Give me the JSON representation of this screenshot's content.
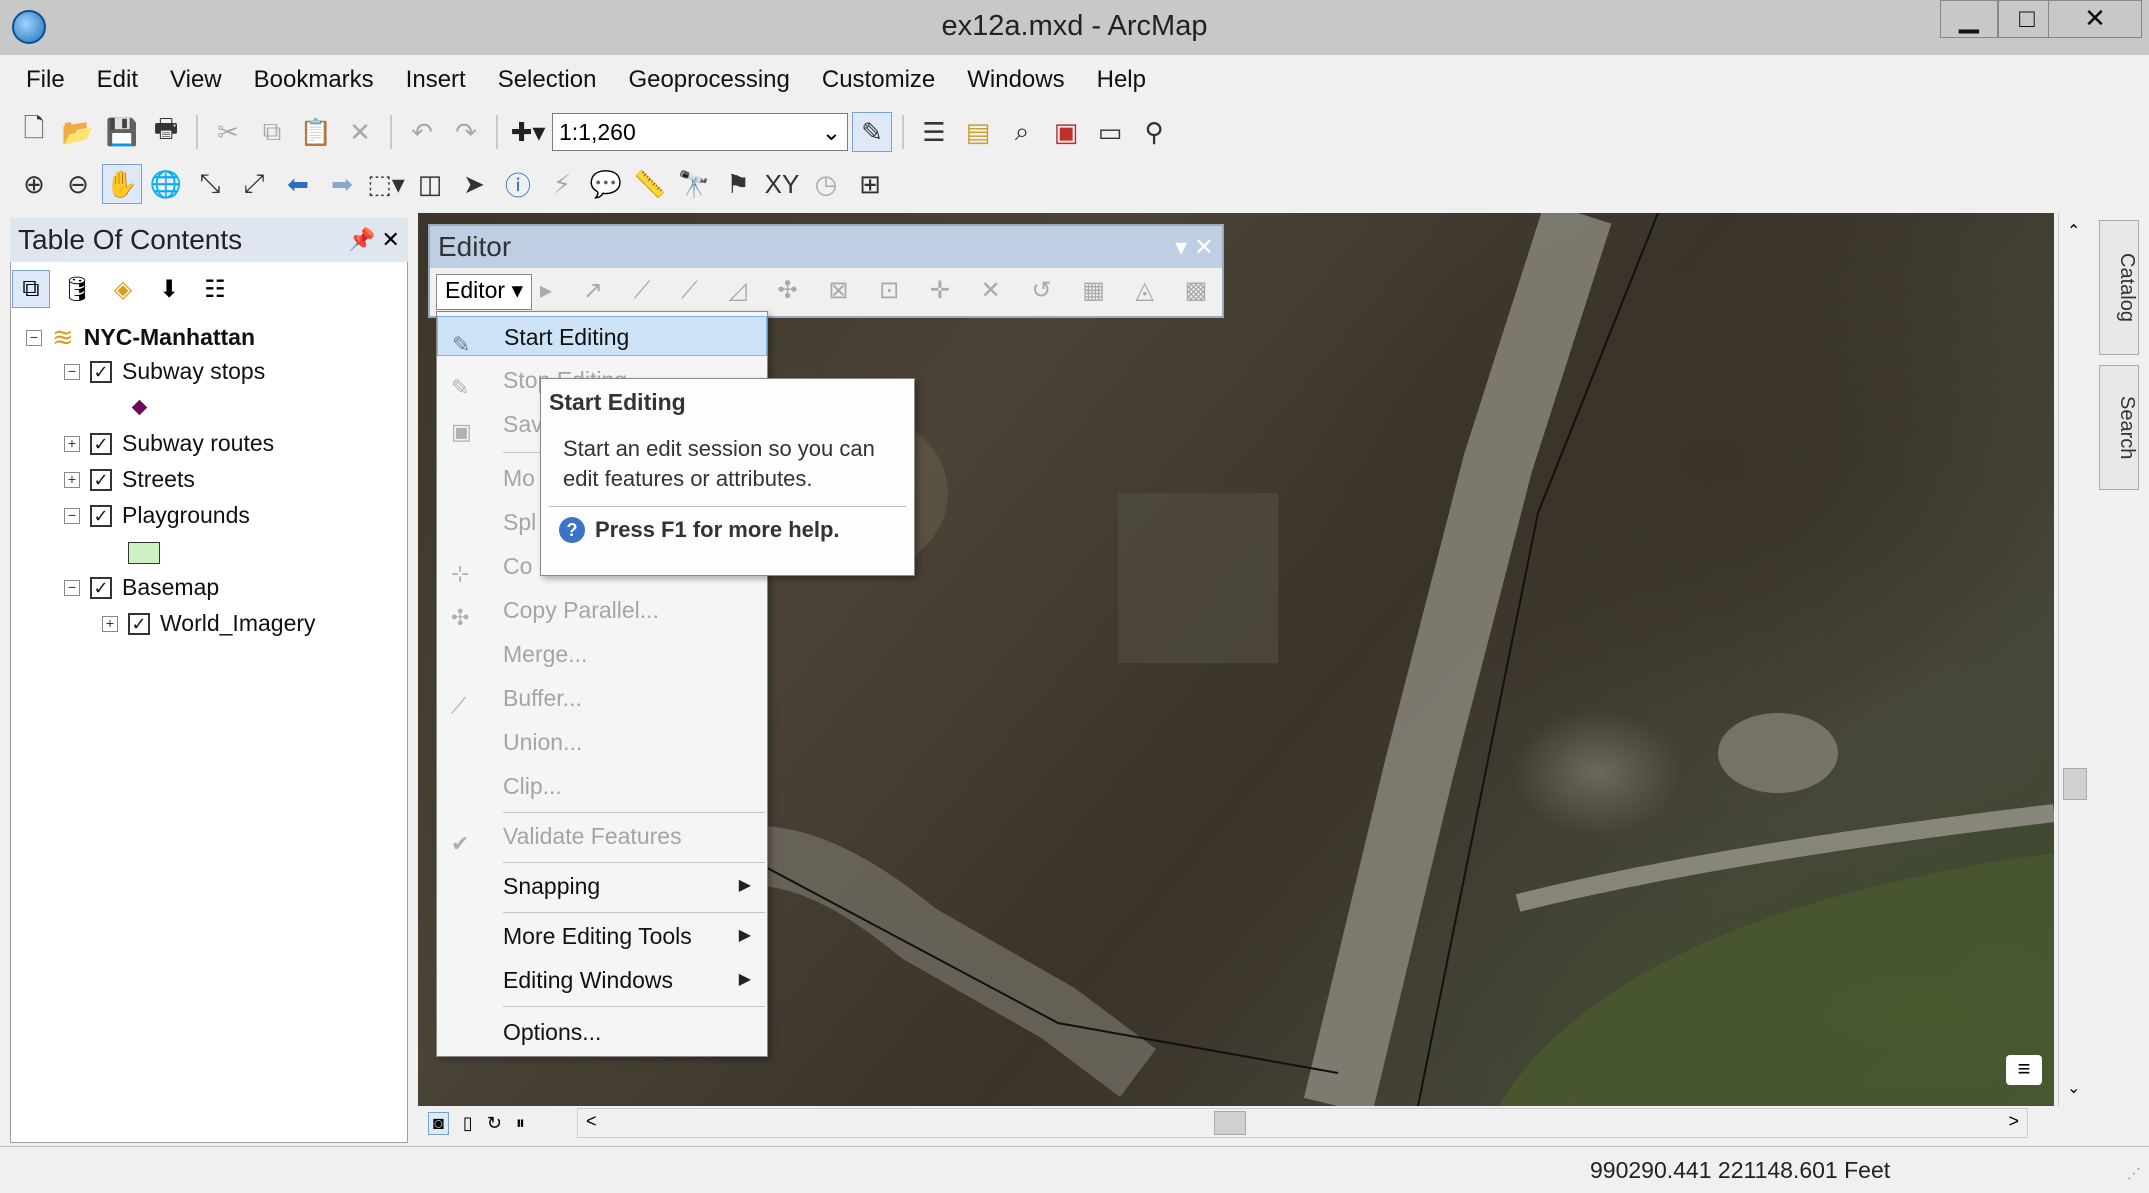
{
  "window": {
    "title": "ex12a.mxd - ArcMap"
  },
  "menubar": [
    "File",
    "Edit",
    "View",
    "Bookmarks",
    "Insert",
    "Selection",
    "Geoprocessing",
    "Customize",
    "Windows",
    "Help"
  ],
  "toolbar": {
    "scale": "1:1,260"
  },
  "toc": {
    "title": "Table Of Contents",
    "layers": {
      "root": "NYC-Manhattan",
      "subway_stops": "Subway stops",
      "subway_routes": "Subway routes",
      "streets": "Streets",
      "playgrounds": "Playgrounds",
      "basemap": "Basemap",
      "world_imagery": "World_Imagery"
    }
  },
  "editor": {
    "title": "Editor",
    "dropdown_label": "Editor",
    "menu": {
      "start": "Start Editing",
      "stop": "Stop Editing",
      "save": "Sav",
      "move": "Mo",
      "split": "Spl",
      "construct": "Co",
      "copy_parallel": "Copy Parallel...",
      "merge": "Merge...",
      "buffer": "Buffer...",
      "union": "Union...",
      "clip": "Clip...",
      "validate": "Validate Features",
      "snapping": "Snapping",
      "more_tools": "More Editing Tools",
      "windows": "Editing Windows",
      "options": "Options..."
    }
  },
  "tooltip": {
    "title": "Start Editing",
    "body": "Start an edit session so you can edit features or attributes.",
    "help": "Press F1 for more help."
  },
  "sidetabs": {
    "catalog": "Catalog",
    "search": "Search"
  },
  "status": {
    "coords": "990290.441  221148.601 Feet"
  }
}
